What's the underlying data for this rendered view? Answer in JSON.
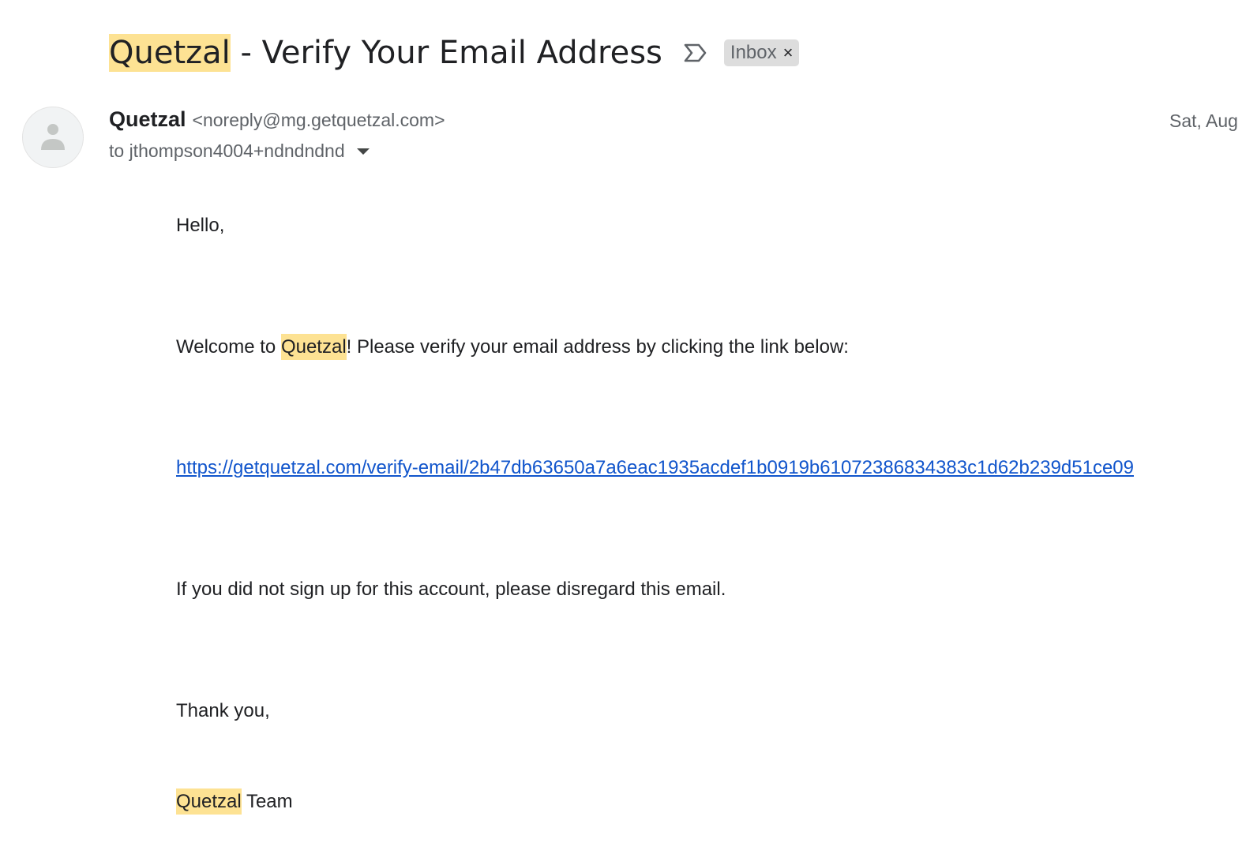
{
  "subject": {
    "highlight": "Quetzal",
    "rest": " - Verify Your Email Address",
    "label": "Inbox",
    "label_close": "×"
  },
  "sender": {
    "name": "Quetzal",
    "email": "<noreply@mg.getquetzal.com>",
    "date": "Sat, Aug",
    "to": "to jthompson4004+ndndndnd"
  },
  "body": {
    "greeting": "Hello,",
    "welcome_before": "Welcome to ",
    "welcome_highlight": "Quetzal",
    "welcome_after": "! Please verify your email address by clicking the link below:",
    "link": "https://getquetzal.com/verify-email/2b47db63650a7a6eac1935acdef1b0919b61072386834383c1d62b239d51ce09",
    "disclaimer": "If you did not sign up for this account, please disregard this email.",
    "thanks": "Thank you,",
    "signature_highlight": "Quetzal",
    "signature_rest": " Team"
  },
  "icons": {
    "important_marker": "importance-marker-icon",
    "avatar": "default-avatar-icon",
    "details": "dropdown-arrow-icon"
  },
  "colors": {
    "highlight": "#fde293",
    "link": "#1155cc",
    "muted_text": "#5f6368",
    "chip_background": "#dddddd"
  }
}
